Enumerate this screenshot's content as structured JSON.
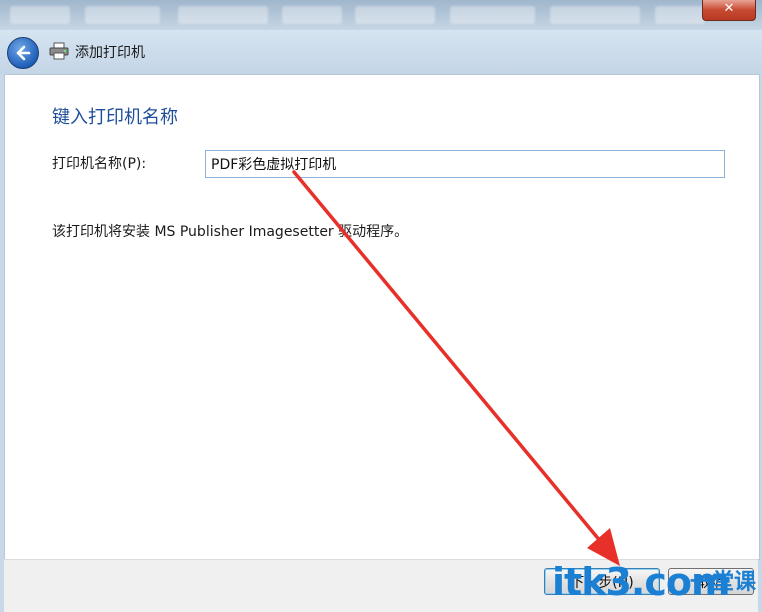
{
  "window": {
    "title": "添加打印机",
    "close_glyph": "✕"
  },
  "page": {
    "heading": "键入打印机名称",
    "printer_name_label": "打印机名称(P):",
    "printer_name_value": "PDF彩色虚拟打印机",
    "driver_info": "该打印机将安装 MS Publisher Imagesetter 驱动程序。"
  },
  "footer": {
    "next_label": "下一步(N)",
    "cancel_label": "取消"
  },
  "watermark": {
    "logo": "itk3.com",
    "tagline": "一堂课"
  },
  "colors": {
    "heading": "#1f4f9a",
    "annotation_arrow": "#e8302a",
    "watermark": "#1b7fd4"
  }
}
